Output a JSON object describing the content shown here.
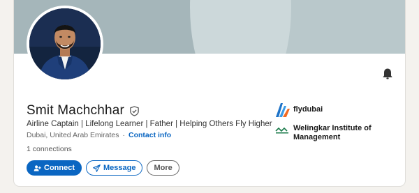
{
  "profile": {
    "name": "Smit Machchhar",
    "headline": "Airline Captain | Lifelong Learner | Father | Helping Others Fly Higher",
    "location": "Dubai, United Arab Emirates",
    "separator": "·",
    "contact_label": "Contact info",
    "connections": "1 connections"
  },
  "actions": {
    "connect_label": "Connect",
    "message_label": "Message",
    "more_label": "More"
  },
  "organizations": [
    {
      "name": "flydubai",
      "logo": "flydubai-logo"
    },
    {
      "name": "Welingkar Institute of Management",
      "logo": "welingkar-logo"
    }
  ],
  "colors": {
    "accent": "#0a66c2",
    "banner": "#a5b6ba",
    "page_bg": "#f4f2ee",
    "flydubai_blue": "#1e73c8",
    "flydubai_orange": "#f26a21"
  },
  "icons": {
    "bell": "bell-icon",
    "verified": "verified-shield-icon",
    "connect": "add-person-icon",
    "message": "send-icon"
  }
}
